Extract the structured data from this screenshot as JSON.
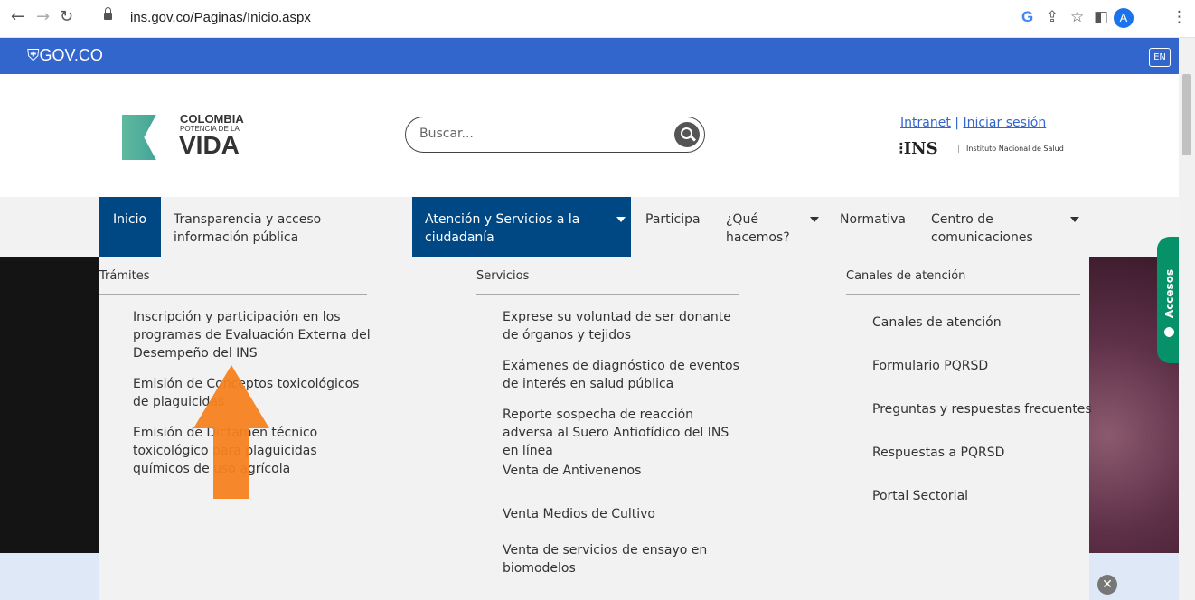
{
  "browser": {
    "url": "ins.gov.co/Paginas/Inicio.aspx",
    "avatar_letter": "A"
  },
  "govbar": {
    "logo_text": "GOV.CO",
    "lang_button": "EN"
  },
  "header": {
    "logo": {
      "line1": "COLOMBIA",
      "line2": "POTENCIA DE LA",
      "line3": "VIDA"
    },
    "search_placeholder": "Buscar...",
    "intranet_link": "Intranet",
    "separator": "|",
    "login_link": "Iniciar sesión",
    "ins_logo": "INS",
    "ins_name": "Instituto Nacional de Salud"
  },
  "nav": {
    "items": [
      {
        "label": "Inicio"
      },
      {
        "label": "Transparencia y acceso información pública"
      },
      {
        "label": "Atención y Servicios a la ciudadanía"
      },
      {
        "label": "Participa"
      },
      {
        "label": "¿Qué hacemos?"
      },
      {
        "label": "Normativa"
      },
      {
        "label": "Centro de comunicaciones"
      }
    ]
  },
  "dropdown": {
    "tramites": {
      "heading": "Trámites",
      "links": [
        "Inscripción y participación en los programas de Evaluación Externa del Desempeño del INS",
        "Emisión de Conceptos toxicológicos de plaguicidas",
        "Emisión de Dictamen técnico toxicológico para plaguicidas químicos de uso agrícola"
      ]
    },
    "servicios": {
      "heading": "Servicios",
      "links": [
        "Exprese su voluntad de ser donante de órganos y tejidos",
        "Exámenes de diagnóstico de eventos de interés en salud pública",
        "Reporte sospecha de reacción adversa al Suero Antiofídico del INS en línea",
        "Venta de Antivenenos",
        "Venta Medios de Cultivo",
        "Venta de servicios de ensayo en biomodelos"
      ]
    },
    "canales": {
      "heading": "Canales de atención",
      "links": [
        "Canales de atención",
        "Formulario PQRSD",
        "Preguntas y respuestas frecuentes",
        "Respuestas a PQRSD",
        "Portal Sectorial"
      ]
    }
  },
  "accesos_tab": "Accesos",
  "colors": {
    "gov_blue": "#3366cc",
    "nav_active": "#004884",
    "accesos_green": "#069169",
    "arrow_orange": "#f58220"
  }
}
